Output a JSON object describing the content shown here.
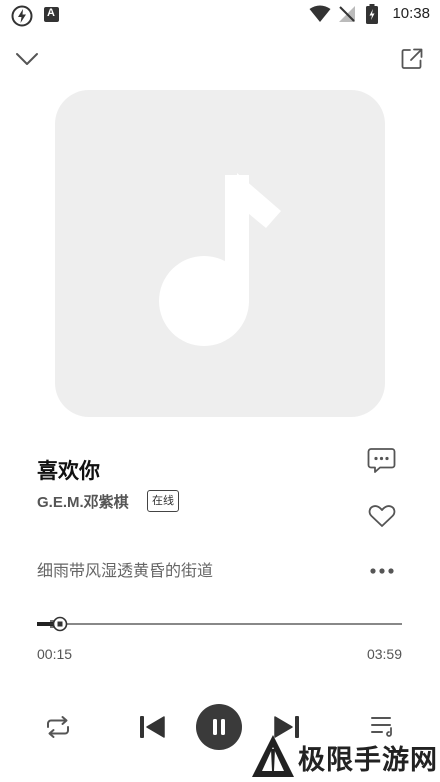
{
  "status_bar": {
    "time": "10:38",
    "badge": "A"
  },
  "song": {
    "title": "喜欢你",
    "artist": "G.E.M.邓紫棋",
    "badge": "在线"
  },
  "lyrics": {
    "current_line": "细雨带风湿透黄昏的街道"
  },
  "progress": {
    "current": "00:15",
    "total": "03:59",
    "fraction": 0.063
  },
  "player": {
    "state": "playing"
  },
  "watermark": {
    "text": "极限手游网"
  },
  "icons": {
    "collapse": "chevron-down-icon",
    "share": "share-icon",
    "comment": "comment-icon",
    "favorite": "heart-icon",
    "more": "more-icon",
    "repeat": "repeat-icon",
    "previous": "previous-icon",
    "pause": "pause-icon",
    "next": "next-icon",
    "playlist": "playlist-icon"
  }
}
